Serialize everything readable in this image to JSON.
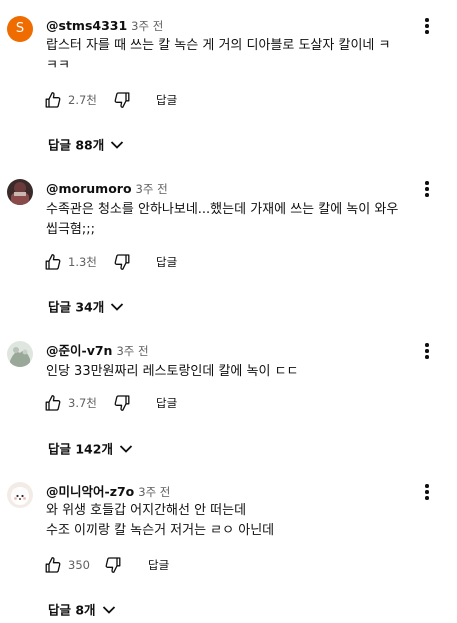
{
  "comments": [
    {
      "author": "@stms4331",
      "time": "3주 전",
      "avatar_letter": "S",
      "avatar_color": "#ef6c00",
      "text_lines": [
        "랍스터 자를 때 쓰는 칼 녹슨 게 거의 디아블로 도살자 칼이네 ㅋ",
        "ㅋㅋ"
      ],
      "likes": "2.7천",
      "reply_label": "답글",
      "replies_label": "답글 88개"
    },
    {
      "author": "@morumoro",
      "time": "3주 전",
      "avatar_icon": "profile-photo-icon",
      "text_lines": [
        "수족관은 청소를 안하나보네...했는데 가재에 쓰는 칼에 녹이 와우",
        "씹극혐;;;"
      ],
      "likes": "1.3천",
      "reply_label": "답글",
      "replies_label": "답글 34개"
    },
    {
      "author": "@준이-v7n",
      "time": "3주 전",
      "avatar_icon": "profile-photo-icon",
      "text_lines": [
        "인당 33만원짜리 레스토랑인데 칼에 녹이 ㄷㄷ"
      ],
      "likes": "3.7천",
      "reply_label": "답글",
      "replies_label": "답글 142개"
    },
    {
      "author": "@미니악어-z7o",
      "time": "3주 전",
      "avatar_icon": "profile-photo-icon",
      "text_lines": [
        "와 위생 호들갑 어지간해선 안 떠는데",
        "수조 이끼랑 칼 녹슨거 저거는 ㄹㅇ 아닌데"
      ],
      "likes": "350",
      "reply_label": "답글",
      "replies_label": "답글 8개"
    }
  ],
  "icons": {
    "like": "thumbs-up-icon",
    "dislike": "thumbs-down-icon",
    "more": "more-vert-icon",
    "expand": "chevron-down-icon"
  },
  "colors": {
    "text_primary": "#0f0f0f",
    "text_secondary": "#606060",
    "background": "#ffffff"
  }
}
